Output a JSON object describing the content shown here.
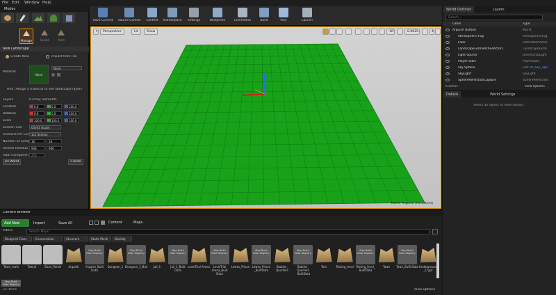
{
  "menu": [
    "File",
    "Edit",
    "Window",
    "Help"
  ],
  "modes": {
    "tab_label": "Modes",
    "mode_tools": [
      "Manage",
      "Sculpt",
      "Paint"
    ],
    "section_title": "New Landscape",
    "radio_create": "Create New",
    "radio_import": "Import from File",
    "material_label": "Material",
    "material_thumb": "None",
    "material_value": "None",
    "hint": "Hint: Assign a material to see landscape layers",
    "layers_label": "Layers",
    "layers_value": "0 Array elements",
    "location_label": "Location",
    "location_values": [
      "0.0",
      "0.0",
      "100.0"
    ],
    "rotation_label": "Rotation",
    "rotation_values": [
      "0.0",
      "0.0",
      "100.0"
    ],
    "scale_label": "Scale",
    "scale_values": [
      "100.0",
      "100.0",
      "100.0"
    ],
    "section_size_label": "Section Size",
    "section_size_value": "63x63 Quads",
    "sections_per_comp_label": "Sections Per Cor",
    "sections_per_comp_value": "1x1 Section",
    "num_components_label": "Number of Comp",
    "num_components_values": [
      "16",
      "16"
    ],
    "overall_res_label": "Overall Resoluti",
    "overall_res_values": [
      "946",
      "946"
    ],
    "total_components_label": "Total Componen",
    "total_components_value": "256",
    "fill_world": "Fill World",
    "create": "Create"
  },
  "toolbar": [
    {
      "label": "Save Current",
      "icon": "save-icon",
      "color": "#5a7fb5"
    },
    {
      "label": "Source Control",
      "icon": "source-control-icon",
      "color": "#6c8bb2"
    },
    {
      "label": "Content",
      "icon": "content-icon",
      "color": "#8aa7c9"
    },
    {
      "label": "Marketplace",
      "icon": "marketplace-icon",
      "color": "#7e9bb8"
    },
    {
      "label": "Settings",
      "icon": "settings-icon",
      "color": "#9aa0a8"
    },
    {
      "label": "Blueprints",
      "icon": "blueprints-icon",
      "color": "#8ea9c9"
    },
    {
      "label": "Cinematics",
      "icon": "cinematics-icon",
      "color": "#a9b4c4"
    },
    {
      "label": "Build",
      "icon": "build-icon",
      "color": "#7f9ec2"
    },
    {
      "label": "Play",
      "icon": "play-icon",
      "color": "#9fb9db"
    },
    {
      "label": "Launch",
      "icon": "launch-icon",
      "color": "#a5b0bc"
    }
  ],
  "viewport": {
    "perspective": "Perspective",
    "lit": "Lit",
    "show": "Show",
    "snap_angle": "10°",
    "scale_snap": "0.0625",
    "camera_speed": "4",
    "level_label": "Level: Arguish (Persistent)"
  },
  "outliner": {
    "tab1": "World Outliner",
    "tab2": "Layers",
    "search_placeholder": "Search...",
    "col_label": "Label",
    "col_type": "Type",
    "rows": [
      {
        "label": "Arguish (Editor)",
        "type": "World"
      },
      {
        "label": "Atmospheric Fog",
        "type": "AtmosphericFog"
      },
      {
        "label": "Floor",
        "type": "StaticMeshActor"
      },
      {
        "label": "LandscapeGizmoActiveActor1",
        "type": "LandscapeGizm"
      },
      {
        "label": "Light Source",
        "type": "DirectionalLight"
      },
      {
        "label": "Player Start",
        "type": "PlayerStart"
      },
      {
        "label": "Sky Sphere",
        "type": "Edit BP_Sky_Sph"
      },
      {
        "label": "SkyLight",
        "type": "SkyLight"
      },
      {
        "label": "SphereReflectionCapture",
        "type": "SphereReflection"
      }
    ],
    "count": "8 actors",
    "view_options": "View Options"
  },
  "details": {
    "tab1": "Details",
    "tab2": "World Settings",
    "empty_msg": "Select an object to view details."
  },
  "content_browser": {
    "tab": "Content Browser",
    "add_new": "Add New",
    "import": "Import",
    "save_all": "Save All",
    "path_root": "Content",
    "path_child": "Maps",
    "filters": "Filters",
    "search_placeholder": "Search Maps",
    "filter_chips": [
      "Blueprint Class",
      "Enumeration",
      "Structure",
      "Static Mesh",
      "Blutility"
    ],
    "items": [
      {
        "name": "Town_mats",
        "kind": "folder"
      },
      {
        "name": "Town2",
        "kind": "folder"
      },
      {
        "name": "Zone_Portal",
        "kind": "folder"
      },
      {
        "name": "Arguish",
        "kind": "map"
      },
      {
        "name": "Arguish_Built Data",
        "kind": "data"
      },
      {
        "name": "Dungeon_1",
        "kind": "map"
      },
      {
        "name": "Dungeon_1_BuiltData",
        "kind": "data"
      },
      {
        "name": "Jail_1",
        "kind": "map"
      },
      {
        "name": "Jail_1_Built Data",
        "kind": "data"
      },
      {
        "name": "LevelTrial Arena",
        "kind": "map"
      },
      {
        "name": "LevelTrial Arena_Built Data",
        "kind": "data"
      },
      {
        "name": "Lewes_Prison",
        "kind": "map"
      },
      {
        "name": "Lewes_Prison _BuiltData",
        "kind": "data"
      },
      {
        "name": "Stables_ Quarters",
        "kind": "map"
      },
      {
        "name": "Stables_ Quarters _BuiltData",
        "kind": "data"
      },
      {
        "name": "Test",
        "kind": "map"
      },
      {
        "name": "Testing_level",
        "kind": "map"
      },
      {
        "name": "Testing_level_ BuiltData",
        "kind": "data"
      },
      {
        "name": "Town",
        "kind": "map"
      },
      {
        "name": "Town_Built Data",
        "kind": "data"
      },
      {
        "name": "Underground _Crypt",
        "kind": "map"
      }
    ],
    "thumb_caption": "Map Build Data Registry",
    "count": "22 items",
    "view_options": "View Options"
  },
  "colors": {
    "accent": "#e39900",
    "landscape": "#18a21a",
    "panel": "#232323"
  }
}
